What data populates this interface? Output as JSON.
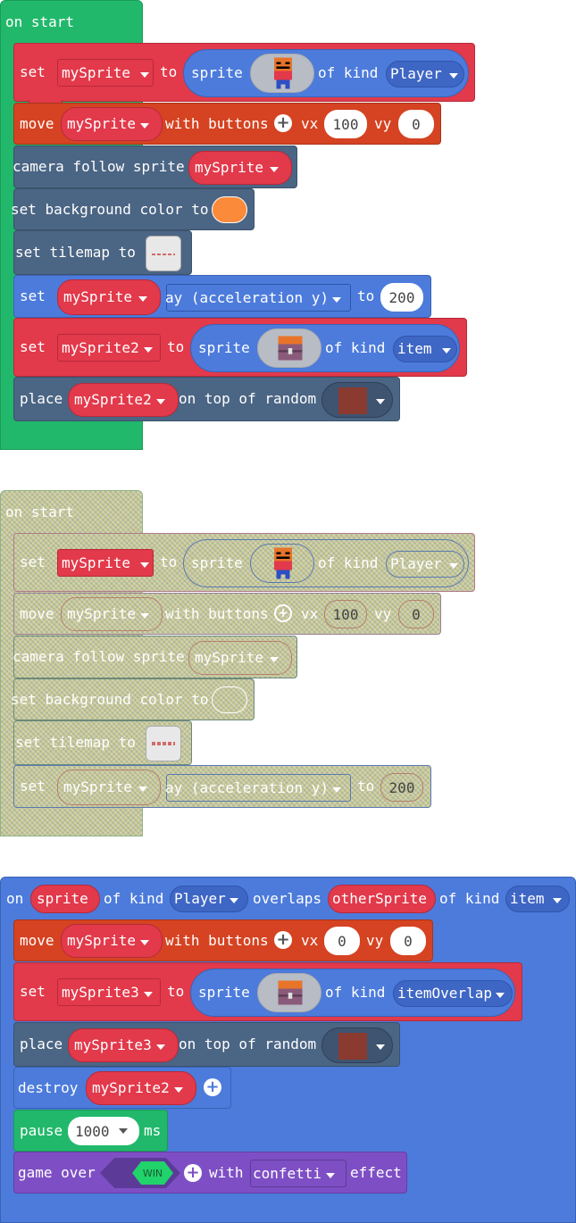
{
  "group1": {
    "hat_label": "on start",
    "set1": {
      "label": "set",
      "var": "mySprite",
      "to": "to",
      "sprite": "sprite",
      "of_kind": "of kind",
      "kind": "Player"
    },
    "move": {
      "label": "move",
      "var": "mySprite",
      "with_buttons": "with buttons",
      "vx_label": "vx",
      "vx": "100",
      "vy_label": "vy",
      "vy": "0"
    },
    "camera": {
      "label": "camera follow sprite",
      "var": "mySprite"
    },
    "bg": {
      "label": "set background color to",
      "color": "#fb8a3a"
    },
    "tilemap": {
      "label": "set tilemap to"
    },
    "set_ay": {
      "label": "set",
      "var": "mySprite",
      "prop": "ay (acceleration y)",
      "to": "to",
      "value": "200"
    },
    "set2": {
      "label": "set",
      "var": "mySprite2",
      "to": "to",
      "sprite": "sprite",
      "of_kind": "of kind",
      "kind": "item"
    },
    "place": {
      "label": "place",
      "var": "mySprite2",
      "on_top": "on top of random"
    }
  },
  "group2": {
    "hat_label": "on start",
    "set1": {
      "label": "set",
      "var": "mySprite",
      "to": "to",
      "sprite": "sprite",
      "of_kind": "of kind",
      "kind": "Player"
    },
    "move": {
      "label": "move",
      "var": "mySprite",
      "with_buttons": "with buttons",
      "vx_label": "vx",
      "vx": "100",
      "vy_label": "vy",
      "vy": "0"
    },
    "camera": {
      "label": "camera follow sprite",
      "var": "mySprite"
    },
    "bg": {
      "label": "set background color to"
    },
    "tilemap": {
      "label": "set tilemap to"
    },
    "set_ay": {
      "label": "set",
      "var": "mySprite",
      "prop": "ay (acceleration y)",
      "to": "to",
      "value": "200"
    }
  },
  "group3": {
    "on": "on",
    "sprite": "sprite",
    "of_kind1": "of kind",
    "kind1": "Player",
    "overlaps": "overlaps",
    "other": "otherSprite",
    "of_kind2": "of kind",
    "kind2": "item",
    "move": {
      "label": "move",
      "var": "mySprite",
      "with_buttons": "with buttons",
      "vx_label": "vx",
      "vx": "0",
      "vy_label": "vy",
      "vy": "0"
    },
    "set3": {
      "label": "set",
      "var": "mySprite3",
      "to": "to",
      "sprite": "sprite",
      "of_kind": "of kind",
      "kind": "itemOverlap"
    },
    "place": {
      "label": "place",
      "var": "mySprite3",
      "on_top": "on top of random"
    },
    "destroy": {
      "label": "destroy",
      "var": "mySprite2"
    },
    "pause": {
      "label": "pause",
      "value": "1000",
      "unit": "ms"
    },
    "gameover": {
      "label": "game over",
      "win": "WIN",
      "with": "with",
      "effect_value": "confetti",
      "effect": "effect"
    }
  },
  "colors": {
    "events": "#21b86b",
    "sprites": "#e2394b",
    "controller": "#d54322",
    "scene": "#4b6584",
    "blue": "#4c7bdb",
    "game": "#7e4fc4",
    "tile": "#8b3a2f"
  },
  "icons": {
    "player": "player-sprite-icon",
    "chest": "treasure-chest-icon",
    "plus": "plus-icon",
    "caret": "caret-down-icon"
  }
}
